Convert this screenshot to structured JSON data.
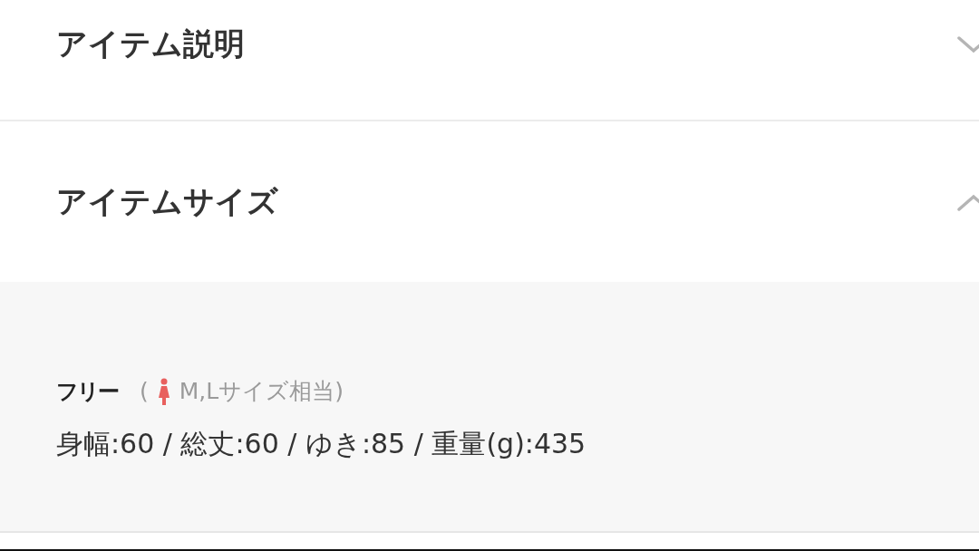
{
  "sections": [
    {
      "title": "アイテム説明",
      "expanded": false
    },
    {
      "title": "アイテムサイズ",
      "expanded": true,
      "size": {
        "label": "フリー",
        "paren": "(",
        "note": "M,Lサイズ相当)",
        "spec": "身幅:60 / 総丈:60 / ゆき:85 / 重量(g):435"
      }
    }
  ]
}
